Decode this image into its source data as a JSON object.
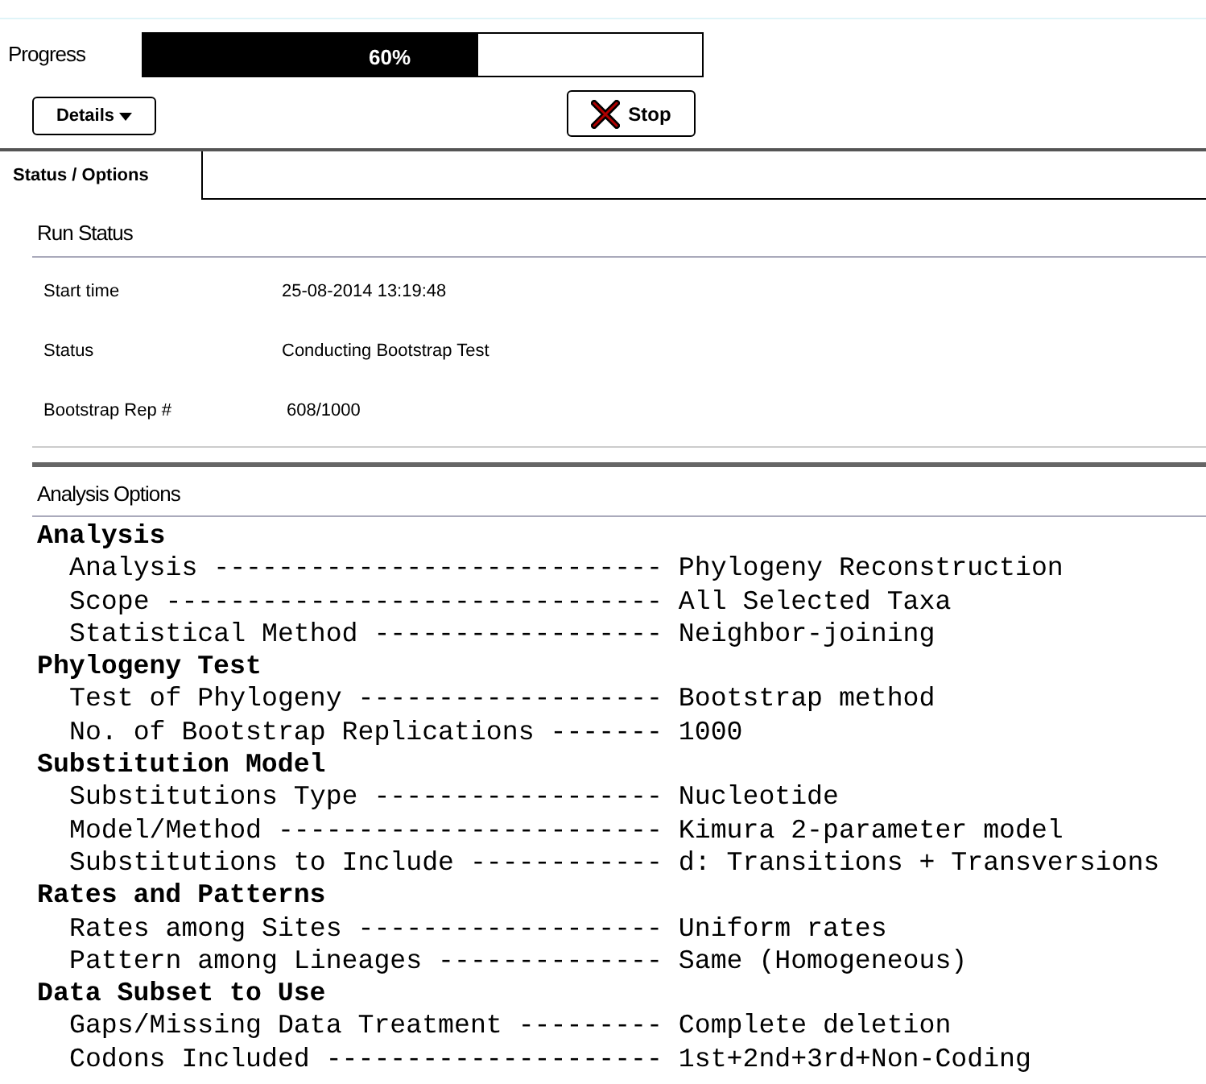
{
  "progress": {
    "label": "Progress",
    "level": 0.6,
    "reading": "60%"
  },
  "buttons": {
    "details": "Details",
    "stop": "Stop"
  },
  "tabs": [
    {
      "label": "Status / Options",
      "selected": true
    }
  ],
  "run_status": {
    "title": "Run Status",
    "rows": [
      {
        "label": "Start time",
        "value": "25-08-2014 13:19:48"
      },
      {
        "label": "Status",
        "value": "Conducting Bootstrap Test"
      },
      {
        "label": "Bootstrap Rep #",
        "value": "608/1000"
      }
    ]
  },
  "analysis_options": {
    "title": "Analysis Options",
    "groups": [
      {
        "heading": "Analysis",
        "lines": [
          "Analysis ---------------------------- Phylogeny Reconstruction",
          "Scope ------------------------------- All Selected Taxa",
          "Statistical Method ------------------ Neighbor-joining"
        ]
      },
      {
        "heading": "Phylogeny Test",
        "lines": [
          "Test of Phylogeny ------------------- Bootstrap method",
          "No. of Bootstrap Replications ------- 1000"
        ]
      },
      {
        "heading": "Substitution Model",
        "lines": [
          "Substitutions Type ------------------ Nucleotide",
          "Model/Method ------------------------ Kimura 2-parameter model",
          "Substitutions to Include ------------ d: Transitions + Transversions"
        ]
      },
      {
        "heading": "Rates and Patterns",
        "lines": [
          "Rates among Sites ------------------- Uniform rates",
          "Pattern among Lineages -------------- Same (Homogeneous)"
        ]
      },
      {
        "heading": "Data Subset to Use",
        "lines": [
          "Gaps/Missing Data Treatment --------- Complete deletion",
          "Codons Included --------------------- 1st+2nd+3rd+Non-Coding"
        ]
      }
    ]
  }
}
